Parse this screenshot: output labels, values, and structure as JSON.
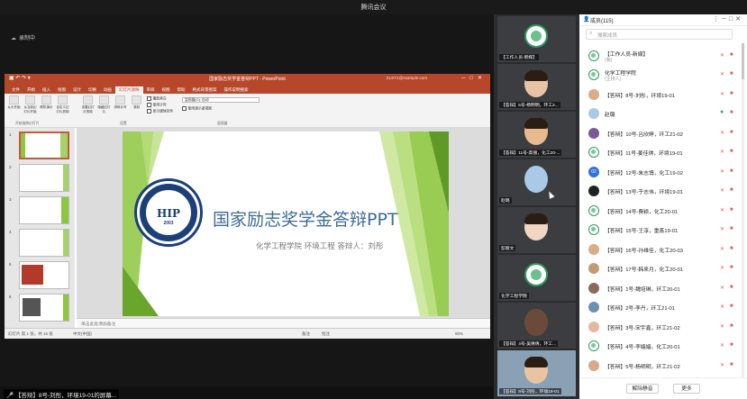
{
  "window": {
    "title": "腾讯会议"
  },
  "share": {
    "status": "录制中"
  },
  "ppt": {
    "title": "国家励志奖学金答辩PPT - PowerPoint",
    "user": "XLSY1@example.com",
    "tabs": [
      "文件",
      "开始",
      "插入",
      "绘图",
      "设计",
      "切换",
      "动画",
      "幻灯片放映",
      "审阅",
      "视图",
      "帮助",
      "格式背景图案",
      "操作说明搜索"
    ],
    "active_tab": "幻灯片放映",
    "ribbon": {
      "buttons": [
        "从头开始",
        "从当前幻灯片开始",
        "联机演示",
        "自定义幻灯片放映",
        "设置幻灯片放映",
        "隐藏幻灯片",
        "排练计时",
        "录制"
      ],
      "checks": [
        "播放旁白",
        "使用计时",
        "显示媒体控件"
      ],
      "monitor_label": "监视器(O): 自动",
      "presenter_view": "使用演示者视图",
      "group_captions": [
        "开始放映幻灯片",
        "设置",
        "监视器"
      ]
    },
    "slide": {
      "title": "国家励志奖学金答辩PPT",
      "subtitle": "化学工程学院  环境工程  答辩人：刘彤",
      "logo_text": "HIP",
      "logo_year": "2003"
    },
    "notes": "单击此处添加备注",
    "status": {
      "slide_info": "幻灯片 第 1 张，共 16 张",
      "lang": "中文(中国)",
      "notes_btn": "备注",
      "comments_btn": "批注",
      "zoom": "90%"
    },
    "thumb_numbers": [
      "1",
      "2",
      "3",
      "4",
      "5",
      "6"
    ]
  },
  "speaker": {
    "label": "【答辩】8号-刘彤，环境19-01的屏幕..."
  },
  "videos": [
    {
      "label": "【工作人员-新媒】"
    },
    {
      "label": "【答辩】5号-杨明明，环工2..."
    },
    {
      "label": "【答辩】11号-高丽，化工20-..."
    },
    {
      "label": "赵璐"
    },
    {
      "label": "彭丽文"
    },
    {
      "label": "化学工程学院"
    },
    {
      "label": "【答辩】4号-吴倩倩，环工..."
    },
    {
      "label": "【答辩】8号-刘彤，环境19-01"
    }
  ],
  "participants": {
    "title": "成员(115)",
    "search_placeholder": "搜索成员",
    "items": [
      {
        "name": "【工作人员-新媒】",
        "role": "(我)"
      },
      {
        "name": "化学工程学院",
        "role": "(主持人)"
      },
      {
        "name": "【答辩】8号-刘彤，环境19-01"
      },
      {
        "name": "赵璐"
      },
      {
        "name": "【答辩】10号-吕欣婷，环工21-02"
      },
      {
        "name": "【答辩】11号-姜佳琪，环境19-01"
      },
      {
        "name": "【答辩】12号-朱志博，化工19-02",
        "avatar_text": "02"
      },
      {
        "name": "【答辩】13号-于志伟，环境19-01"
      },
      {
        "name": "【答辩】14号-费颖，化工20-01"
      },
      {
        "name": "【答辩】15号-王淳，重蒸19-01"
      },
      {
        "name": "【答辩】16号-孙维佳，化工20-03"
      },
      {
        "name": "【答辩】17号-韩来月，化工20-01"
      },
      {
        "name": "【答辩】1号-魏培琳，环工20-01"
      },
      {
        "name": "【答辩】2号-李丹，环工21-01"
      },
      {
        "name": "【答辩】3号-宋宇鑫，环工21-02"
      },
      {
        "name": "【答辩】4号-李嫱嫱，化工20-01"
      },
      {
        "name": "【答辩】5号-杨明明，环工21-02"
      }
    ],
    "unmute_all": "解除静音",
    "more": "更多"
  }
}
